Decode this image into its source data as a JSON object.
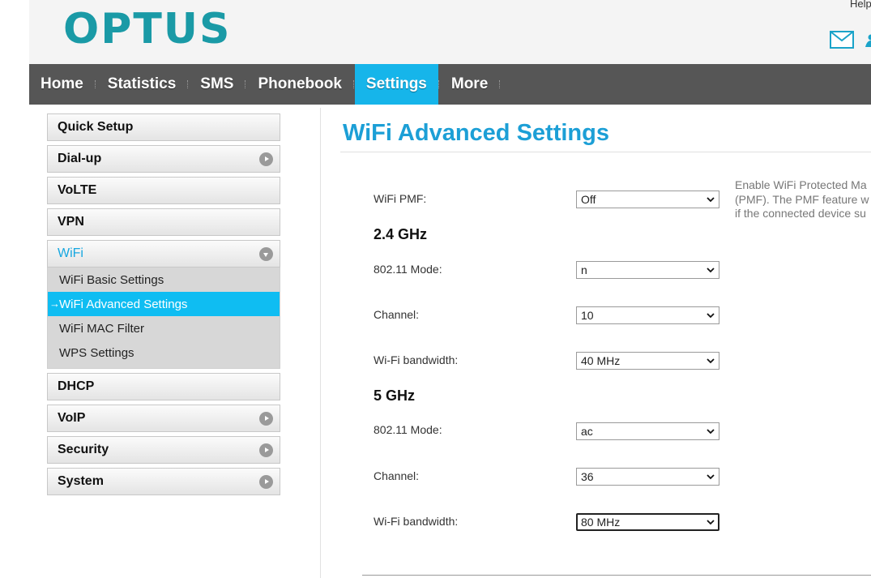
{
  "header": {
    "logo": "OPTUS",
    "help_link": "Help",
    "icons": [
      "mail-icon",
      "user-icon"
    ]
  },
  "nav": {
    "items": [
      {
        "label": "Home"
      },
      {
        "label": "Statistics"
      },
      {
        "label": "SMS"
      },
      {
        "label": "Phonebook"
      },
      {
        "label": "Settings",
        "active": true
      },
      {
        "label": "More"
      }
    ]
  },
  "sidebar": {
    "items": [
      {
        "label": "Quick Setup"
      },
      {
        "label": "Dial-up"
      },
      {
        "label": "VoLTE"
      },
      {
        "label": "VPN"
      },
      {
        "label": "WiFi",
        "expanded": true
      },
      {
        "label": "DHCP"
      },
      {
        "label": "VoIP"
      },
      {
        "label": "Security"
      },
      {
        "label": "System"
      }
    ],
    "wifi_submenu": [
      {
        "label": "WiFi Basic Settings"
      },
      {
        "label": "WiFi Advanced Settings",
        "active": true
      },
      {
        "label": "WiFi MAC Filter"
      },
      {
        "label": "WPS Settings"
      }
    ]
  },
  "main": {
    "title": "WiFi Advanced Settings",
    "pmf": {
      "label": "WiFi PMF:",
      "value": "Off"
    },
    "help_text": [
      "Enable WiFi Protected Ma",
      "(PMF). The PMF feature w",
      "if the connected device su"
    ],
    "band_24": {
      "heading": "2.4 GHz",
      "mode": {
        "label": "802.11 Mode:",
        "value": "n"
      },
      "channel": {
        "label": "Channel:",
        "value": "10"
      },
      "bandwidth": {
        "label": "Wi-Fi bandwidth:",
        "value": "40 MHz"
      }
    },
    "band_5": {
      "heading": "5 GHz",
      "mode": {
        "label": "802.11 Mode:",
        "value": "ac"
      },
      "channel": {
        "label": "Channel:",
        "value": "36"
      },
      "bandwidth": {
        "label": "Wi-Fi bandwidth:",
        "value": "80 MHz"
      }
    }
  },
  "colors": {
    "brand": "#1a9aa6",
    "accent": "#16b5ea",
    "title": "#1c9fd6",
    "nav_bg": "#565656"
  }
}
